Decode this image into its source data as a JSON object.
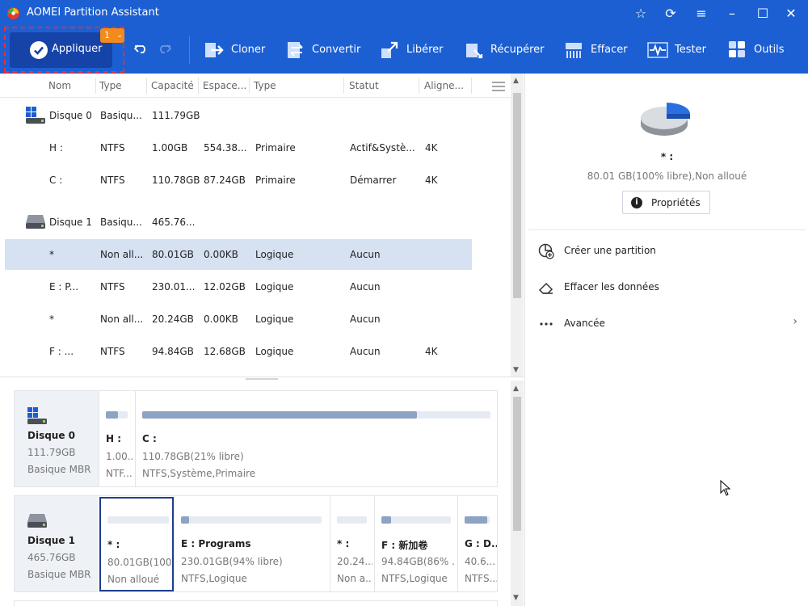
{
  "window": {
    "title": "AOMEI Partition Assistant"
  },
  "toolbar": {
    "apply_label": "Appliquer",
    "apply_badge": "1",
    "tools": [
      {
        "label": "Cloner",
        "icon": "clone-icon"
      },
      {
        "label": "Convertir",
        "icon": "convert-icon"
      },
      {
        "label": "Libérer",
        "icon": "free-up-icon"
      },
      {
        "label": "Récupérer",
        "icon": "recover-icon"
      },
      {
        "label": "Effacer",
        "icon": "wipe-icon"
      },
      {
        "label": "Tester",
        "icon": "test-icon"
      },
      {
        "label": "Outils",
        "icon": "tools-icon"
      }
    ]
  },
  "table": {
    "headers": [
      "Nom",
      "Type",
      "Capacité",
      "Espace...",
      "Type",
      "Statut",
      "Aligne..."
    ],
    "rows": [
      {
        "name": "Disque 0",
        "type": "Basiqu...",
        "capacity": "111.79GB",
        "free": "",
        "ptype": "",
        "status": "",
        "align": "",
        "is_disk": true
      },
      {
        "name": "H :",
        "type": "NTFS",
        "capacity": "1.00GB",
        "free": "554.38...",
        "ptype": "Primaire",
        "status": "Actif&Systè...",
        "align": "4K"
      },
      {
        "name": "C :",
        "type": "NTFS",
        "capacity": "110.78GB",
        "free": "87.24GB",
        "ptype": "Primaire",
        "status": "Démarrer",
        "align": "4K"
      },
      {
        "name": "Disque 1",
        "type": "Basiqu...",
        "capacity": "465.76...",
        "free": "",
        "ptype": "",
        "status": "",
        "align": "",
        "is_disk": true
      },
      {
        "name": "*",
        "type": "Non all...",
        "capacity": "80.01GB",
        "free": "0.00KB",
        "ptype": "Logique",
        "status": "Aucun",
        "align": "",
        "selected": true
      },
      {
        "name": "E : P...",
        "type": "NTFS",
        "capacity": "230.01...",
        "free": "12.02GB",
        "ptype": "Logique",
        "status": "Aucun",
        "align": ""
      },
      {
        "name": "*",
        "type": "Non all...",
        "capacity": "20.24GB",
        "free": "0.00KB",
        "ptype": "Logique",
        "status": "Aucun",
        "align": ""
      },
      {
        "name": "F : ...",
        "type": "NTFS",
        "capacity": "94.84GB",
        "free": "12.68GB",
        "ptype": "Logique",
        "status": "Aucun",
        "align": "4K"
      }
    ]
  },
  "diskmap": {
    "disks": [
      {
        "name": "Disque 0",
        "size": "111.79GB",
        "kind": "Basique MBR",
        "partitions": [
          {
            "name": "H :",
            "line1": "1.00...",
            "line2": "NTF...",
            "used_fraction": 0.55
          },
          {
            "name": "C :",
            "line1": "110.78GB(21% libre)",
            "line2": "NTFS,Système,Primaire",
            "used_fraction": 0.79
          }
        ]
      },
      {
        "name": "Disque 1",
        "size": "465.76GB",
        "kind": "Basique MBR",
        "partitions": [
          {
            "name": "* :",
            "line1": "80.01GB(100...",
            "line2": "Non alloué",
            "used_fraction": 0.0,
            "selected": true
          },
          {
            "name": "E : Programs",
            "line1": "230.01GB(94% libre)",
            "line2": "NTFS,Logique",
            "used_fraction": 0.06
          },
          {
            "name": "* :",
            "line1": "20.24...",
            "line2": "Non a...",
            "used_fraction": 0.0
          },
          {
            "name": "F : 新加卷",
            "line1": "94.84GB(86% ...",
            "line2": "NTFS,Logique",
            "used_fraction": 0.14
          },
          {
            "name": "G : D...",
            "line1": "40.6...",
            "line2": "NTFS...",
            "used_fraction": 0.9
          }
        ]
      }
    ]
  },
  "right_panel": {
    "selected_name": "* :",
    "selected_info": "80.01 GB(100% libre),Non alloué",
    "properties_label": "Propriétés",
    "operations": [
      {
        "label": "Créer une partition",
        "icon": "create-partition-icon"
      },
      {
        "label": "Effacer les données",
        "icon": "eraser-icon"
      },
      {
        "label": "Avancée",
        "icon": "more-icon"
      }
    ]
  },
  "colors": {
    "brand_blue": "#1c5fd2",
    "apply_dark": "#1543a8",
    "badge_orange": "#f28a1c",
    "selection": "#d6e1f2",
    "bar_fill": "#8da3c3"
  }
}
